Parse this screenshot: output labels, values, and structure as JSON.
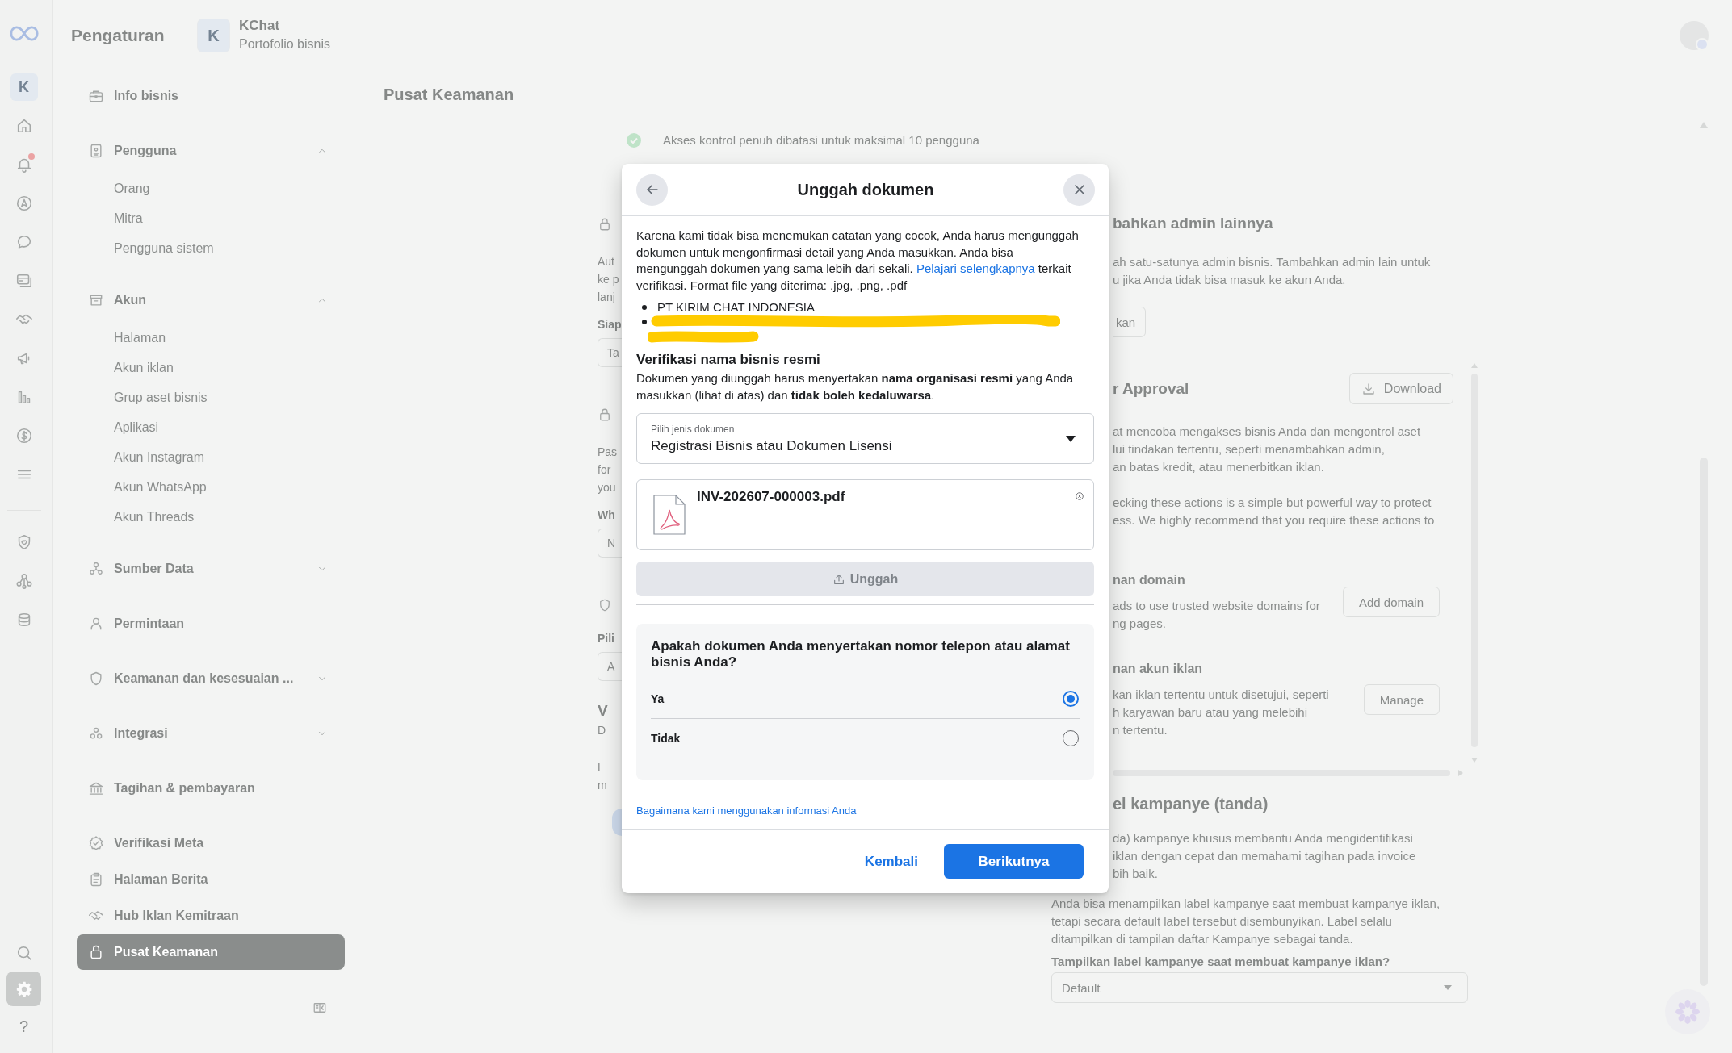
{
  "rail": {
    "account_initial": "K",
    "has_notification": true,
    "settings_selected": true,
    "help": "?"
  },
  "header": {
    "title": "Pengaturan",
    "portfolio_initial": "K",
    "portfolio_name": "KChat",
    "portfolio_type": "Portofolio bisnis"
  },
  "nav": {
    "sections": [
      {
        "items": [
          {
            "kind": "link",
            "label": "Info bisnis",
            "selected": false
          }
        ]
      },
      {
        "items": [
          {
            "kind": "group",
            "label": "Pengguna",
            "selected": false,
            "expanded": true,
            "children": [
              {
                "label": "Orang",
                "selected": false
              },
              {
                "label": "Mitra",
                "selected": false
              },
              {
                "label": "Pengguna sistem",
                "selected": false
              }
            ]
          }
        ]
      },
      {
        "items": [
          {
            "kind": "group",
            "label": "Akun",
            "selected": false,
            "expanded": true,
            "children": [
              {
                "label": "Halaman",
                "selected": false
              },
              {
                "label": "Akun iklan",
                "selected": false
              },
              {
                "label": "Grup aset bisnis",
                "selected": false
              },
              {
                "label": "Aplikasi",
                "selected": false
              },
              {
                "label": "Akun Instagram",
                "selected": false
              },
              {
                "label": "Akun WhatsApp",
                "selected": false
              },
              {
                "label": "Akun Threads",
                "selected": false
              }
            ]
          }
        ]
      },
      {
        "items": [
          {
            "kind": "group",
            "label": "Sumber Data",
            "selected": false,
            "expanded": false
          }
        ]
      },
      {
        "items": [
          {
            "kind": "link",
            "label": "Permintaan",
            "selected": false
          }
        ]
      },
      {
        "items": [
          {
            "kind": "group",
            "label": "Keamanan dan kesesuaian ...",
            "selected": false,
            "expanded": false
          }
        ]
      },
      {
        "items": [
          {
            "kind": "group",
            "label": "Integrasi",
            "selected": false,
            "expanded": false
          }
        ]
      },
      {
        "items": [
          {
            "kind": "link",
            "label": "Tagihan & pembayaran",
            "selected": false
          }
        ]
      },
      {
        "items": [
          {
            "kind": "link",
            "label": "Verifikasi Meta",
            "selected": false
          },
          {
            "kind": "link",
            "label": "Halaman Berita",
            "selected": false
          },
          {
            "kind": "link",
            "label": "Hub Iklan Kemitraan",
            "selected": false
          },
          {
            "kind": "link",
            "label": "Pusat Keamanan",
            "selected": true
          }
        ]
      }
    ]
  },
  "page": {
    "title": "Pusat Keamanan",
    "notice": "Akses kontrol penuh dibatasi untuk maksimal 10 pengguna"
  },
  "side_card": [
    {
      "lines": "Aut\nke p\nlanj",
      "label": "Siap",
      "field": "Ta"
    },
    {
      "lines": "Pas\nfor\nyou",
      "label": "Wh",
      "field": "N"
    },
    {
      "label": "Pili",
      "field": "A"
    },
    {
      "heading": "V",
      "lines": "D"
    },
    {
      "lines": "L\nm"
    }
  ],
  "right_panel": {
    "admin_heading": "bahkan admin lainnya",
    "admin_text": "ah satu-satunya admin bisnis. Tambahkan admin lain untuk\nu jika Anda tidak bisa masuk ke akun Anda.",
    "admin_button": "kan",
    "approval": {
      "heading": "r Approval",
      "download": "Download",
      "text_1": "at mencoba mengakses bisnis Anda dan mengontrol aset\nlui tindakan tertentu, seperti menambahkan admin,\nan batas kredit, atau menerbitkan iklan.",
      "text_2": "ecking these actions is a simple but powerful way to protect\ness. We highly recommend that you require these actions to",
      "settings": [
        {
          "heading": "nan domain",
          "text": "ads to use trusted website domains for\nng pages.",
          "button": "Add domain"
        },
        {
          "heading": "nan akun iklan",
          "text": "kan iklan tertentu untuk disetujui, seperti\nh karyawan baru atau yang melebihi\nn tertentu.",
          "button": "Manage"
        }
      ]
    },
    "campaign": {
      "heading": "el kampanye (tanda)",
      "text_cut": "da) kampanye khusus membantu Anda mengidentifikasi\niklan dengan cepat dan memahami tagihan pada invoice\nbih baik.",
      "text": "Anda bisa menampilkan label kampanye saat membuat kampanye iklan,\ntetapi secara default label tersebut disembunyikan. Label selalu\nditampilkan di tampilan daftar Kampanye sebagai tanda.",
      "question": "Tampilkan label kampanye saat membuat kampanye iklan?",
      "select_value": "Default"
    }
  },
  "dialog": {
    "title": "Unggah dokumen",
    "intro": {
      "before": "Karena kami tidak bisa menemukan catatan yang cocok, Anda harus mengunggah dokumen untuk mengonfirmasi detail yang Anda masukkan. Anda bisa mengunggah dokumen yang sama lebih dari sekali.",
      "link": "Pelajari selengkapnya",
      "after": "terkait verifikasi. Format file yang diterima: .jpg, .png, .pdf"
    },
    "entities": [
      {
        "text": "PT KIRIM CHAT INDONESIA",
        "redacted": false
      },
      {
        "redacted": true
      }
    ],
    "heading": "Verifikasi nama bisnis resmi",
    "requirement": "Dokumen yang diunggah harus menyertakan **nama organisasi resmi** yang Anda masukkan (lihat di atas) dan **tidak boleh kedaluwarsa**.",
    "document_type": {
      "label": "Pilih jenis dokumen",
      "value": "Registrasi Bisnis atau Dokumen Lisensi"
    },
    "file": {
      "name": "INV-202607-000003.pdf"
    },
    "upload_button": {
      "label": "Unggah",
      "disabled": true
    },
    "question": {
      "text": "Apakah dokumen Anda menyertakan nomor telepon atau alamat bisnis Anda?",
      "options": [
        {
          "label": "Ya",
          "selected": true
        },
        {
          "label": "Tidak",
          "selected": false
        }
      ]
    },
    "privacy_link": "Bagaimana kami menggunakan informasi Anda",
    "back_label": "Kembali",
    "next_label": "Berikutnya"
  }
}
